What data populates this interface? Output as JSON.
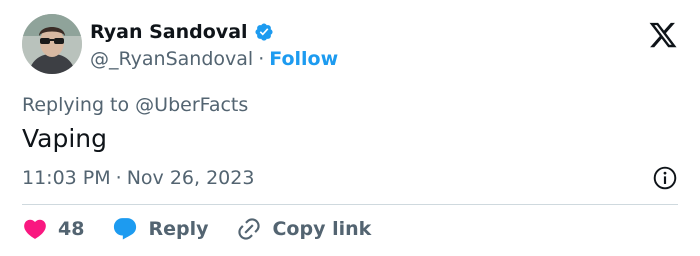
{
  "user": {
    "display_name": "Ryan Sandoval",
    "handle": "@_RyanSandoval",
    "follow_label": "Follow",
    "verified": true
  },
  "tweet": {
    "replying_prefix": "Replying to",
    "replying_to": "@UberFacts",
    "text": "Vaping",
    "time": "11:03 PM",
    "date": "Nov 26, 2023"
  },
  "actions": {
    "like_count": "48",
    "reply_label": "Reply",
    "copy_link_label": "Copy link"
  },
  "icons": {
    "brand": "x-logo-icon",
    "verified": "verified-badge-icon",
    "info": "info-icon",
    "like": "heart-icon",
    "reply": "speech-bubble-icon",
    "copy_link": "link-icon"
  },
  "colors": {
    "accent": "#1d9bf0",
    "like": "#f91880",
    "text": "#0f1419",
    "muted": "#536471"
  }
}
